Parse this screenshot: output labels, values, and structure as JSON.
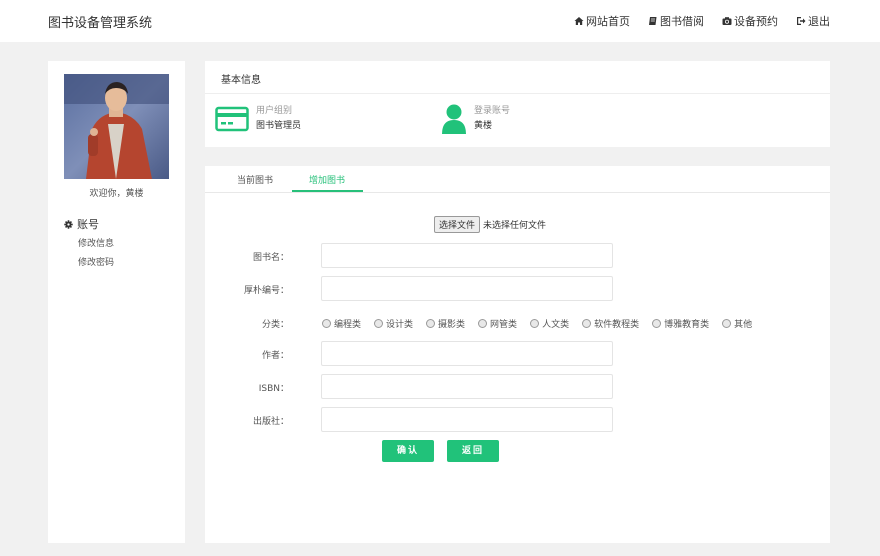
{
  "app": {
    "title": "图书设备管理系统"
  },
  "nav": [
    {
      "icon": "home-icon",
      "label": "网站首页"
    },
    {
      "icon": "book-icon",
      "label": "图书借阅"
    },
    {
      "icon": "camera-icon",
      "label": "设备预约"
    },
    {
      "icon": "logout-icon",
      "label": "退出"
    }
  ],
  "sidebar": {
    "welcome": "欢迎你，黄楼",
    "menu_title": "账号",
    "links": [
      "修改信息",
      "修改密码"
    ]
  },
  "info": {
    "header": "基本信息",
    "group_label": "用户组别",
    "group_value": "图书管理员",
    "account_label": "登录账号",
    "account_value": "黄楼"
  },
  "tabs": [
    "当前图书",
    "增加图书"
  ],
  "form": {
    "file_button": "选择文件",
    "file_status": "未选择任何文件",
    "fields": {
      "name": "图书名：",
      "code": "厚朴编号：",
      "category": "分类：",
      "author": "作者：",
      "isbn": "ISBN：",
      "publisher": "出版社："
    },
    "categories": [
      "编程类",
      "设计类",
      "摄影类",
      "网管类",
      "人文类",
      "软件教程类",
      "博雅教育类",
      "其他"
    ],
    "confirm": "确认",
    "back": "返回"
  },
  "colors": {
    "accent": "#21c27a"
  }
}
